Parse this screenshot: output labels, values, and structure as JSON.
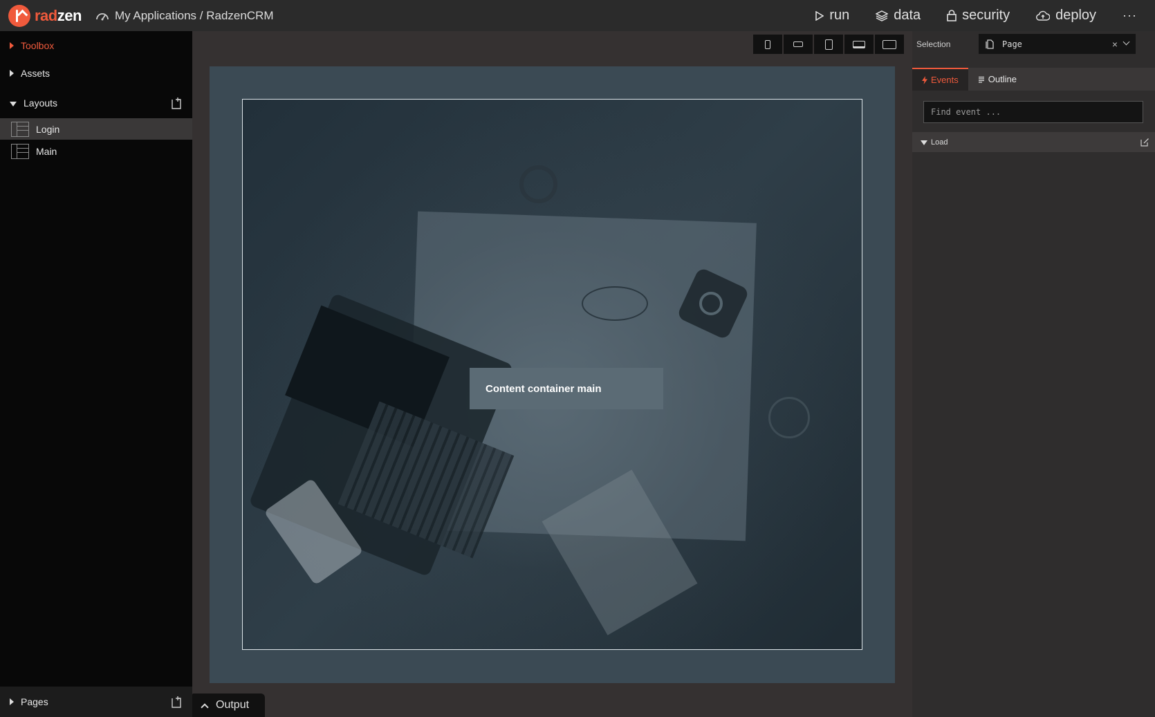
{
  "header": {
    "logo_rad": "rad",
    "logo_zen": "zen",
    "breadcrumb": "My Applications / RadzenCRM",
    "nav": {
      "run": "run",
      "data": "data",
      "security": "security",
      "deploy": "deploy",
      "more": "···"
    }
  },
  "sidebar": {
    "toolbox": "Toolbox",
    "assets": "Assets",
    "layouts": "Layouts",
    "layout_items": [
      "Login",
      "Main"
    ],
    "pages": "Pages"
  },
  "canvas": {
    "devices": [
      "phone-portrait",
      "phone-landscape",
      "tablet-portrait",
      "laptop",
      "desktop"
    ],
    "content_label": "Content container main"
  },
  "output": {
    "label": "Output"
  },
  "right_panel": {
    "selection_label": "Selection",
    "selection_value": "Page",
    "clear": "×",
    "tabs": {
      "events": "Events",
      "outline": "Outline"
    },
    "find_placeholder": "Find event ...",
    "events": [
      "Load"
    ]
  },
  "colors": {
    "accent": "#f05a3c",
    "topbar": "#2b2b2b",
    "sidebar": "#080808",
    "canvas": "#353131",
    "page_frame": "#3b4a54",
    "content_label_bg": "#5b6b75"
  }
}
